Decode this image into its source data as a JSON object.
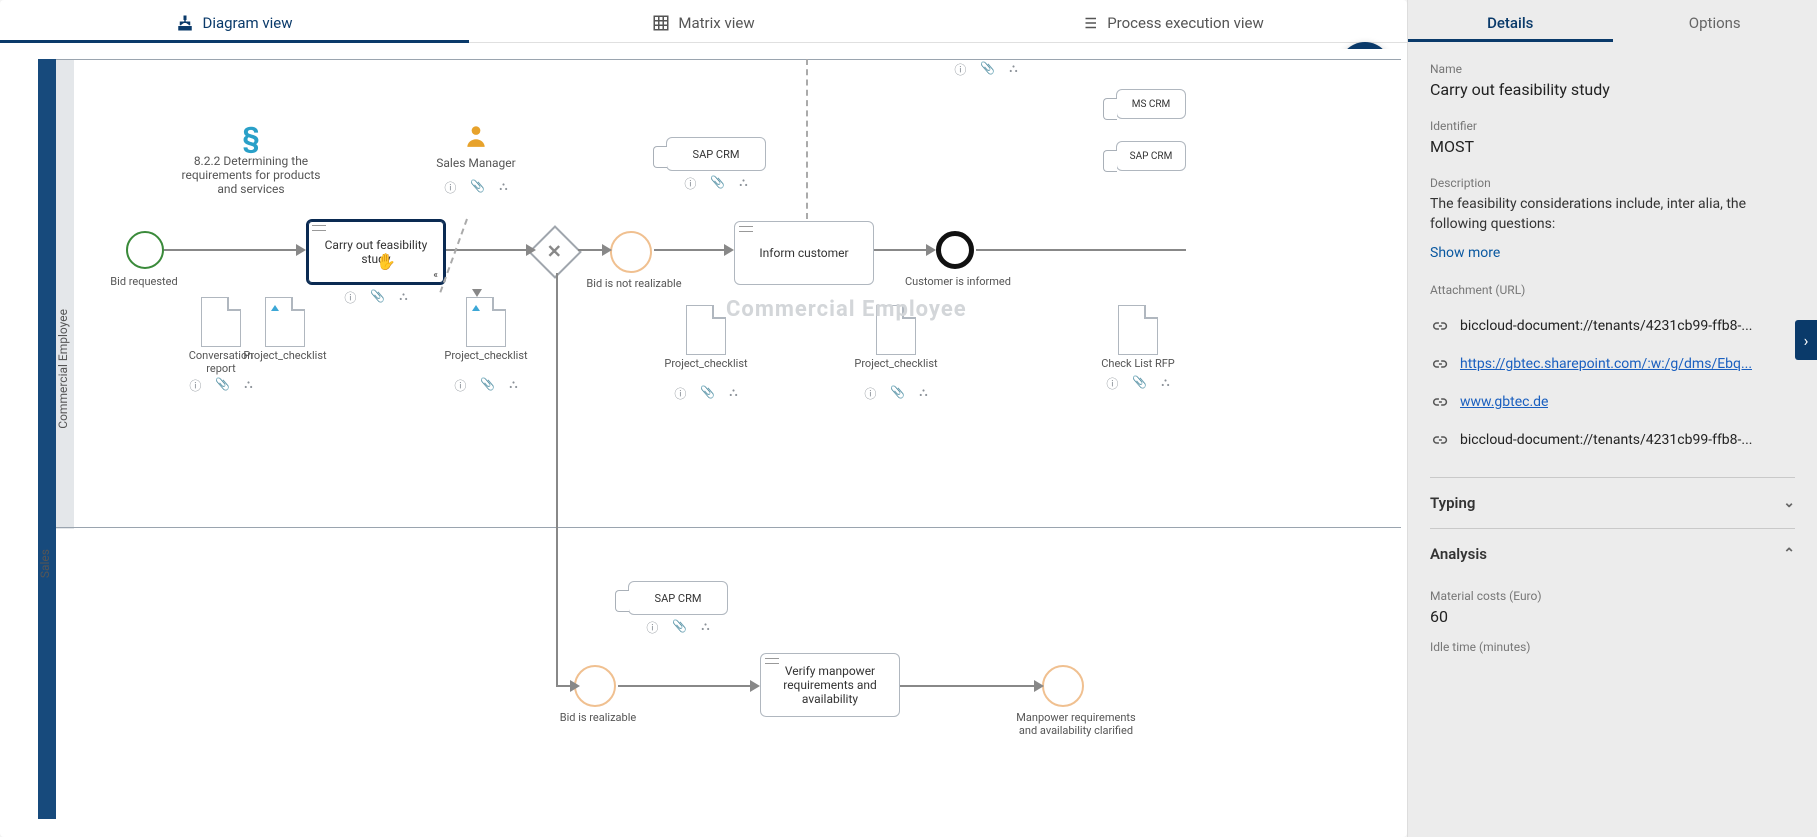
{
  "tabs": {
    "diagram": "Diagram view",
    "matrix": "Matrix view",
    "execution": "Process execution view"
  },
  "pool": {
    "name": "Sales",
    "lane": "Commercial Employee"
  },
  "roles": {
    "regulation": "8.2.2 Determining the requirements for products and services",
    "salesManager": "Sales Manager"
  },
  "nodes": {
    "start": "Bid requested",
    "task1": "Carry out feasibility study",
    "notRealizable": "Bid is not realizable",
    "inform": "Inform customer",
    "end": "Customer is informed",
    "realizable": "Bid is realizable",
    "verify": "Verify manpower requirements and availability",
    "clarified": "Manpower requirements and availability clarified",
    "sapcrm": "SAP CRM",
    "mscrm": "MS CRM",
    "checklist": "Check List RFP",
    "watermark": "Commercial Employee"
  },
  "docs": {
    "conv": "Conversation report",
    "pchk1": "Project_checklist",
    "pchk2": "Project_checklist",
    "pchk3": "Project_checklist",
    "pchk4": "Project_checklist"
  },
  "panel": {
    "tabs": {
      "details": "Details",
      "options": "Options"
    },
    "name_label": "Name",
    "name": "Carry out feasibility study",
    "identifier_label": "Identifier",
    "identifier": "MOST",
    "description_label": "Description",
    "description": "The feasibility considerations include, inter alia, the following questions:",
    "show_more": "Show more",
    "attachment_label": "Attachment (URL)",
    "attachments": [
      {
        "text": "biccloud-document://tenants/4231cb99-ffb8-...",
        "link": false
      },
      {
        "text": "https://gbtec.sharepoint.com/:w:/g/dms/Ebq...",
        "link": true
      },
      {
        "text": "www.gbtec.de",
        "link": true
      },
      {
        "text": "biccloud-document://tenants/4231cb99-ffb8-...",
        "link": false
      }
    ],
    "typing": "Typing",
    "analysis": "Analysis",
    "material_label": "Material costs (Euro)",
    "material": "60",
    "idle_label": "Idle time (minutes)"
  }
}
